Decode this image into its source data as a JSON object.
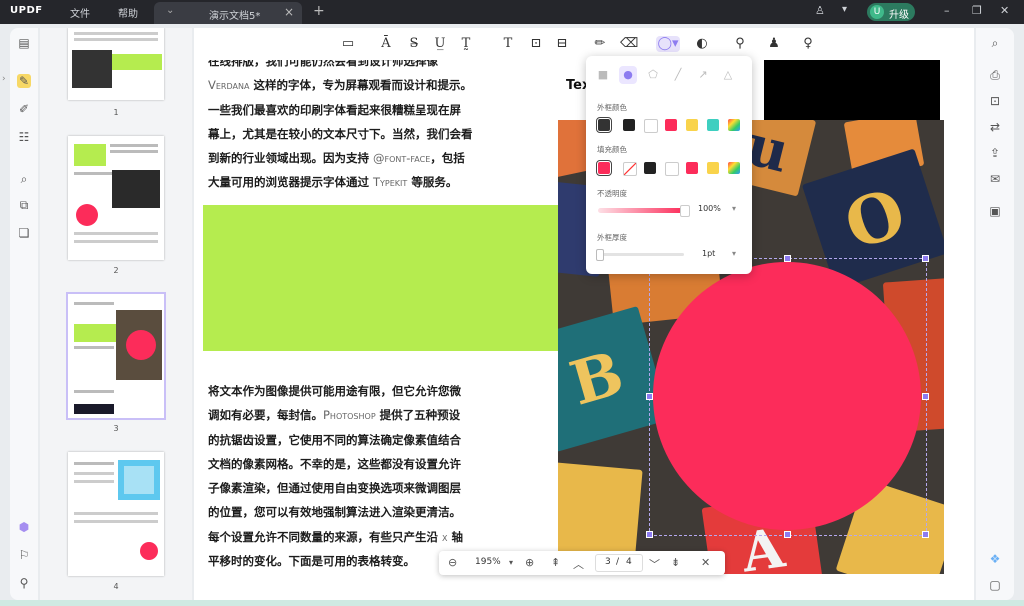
{
  "app": {
    "logo": "UPDF",
    "menu": [
      "文件",
      "帮助"
    ],
    "tab_title": "演示文档5*",
    "tab_close": "×",
    "new_tab": "+",
    "upgrade_avatar": "U",
    "upgrade_label": "升级",
    "window_controls": [
      "–",
      "❐",
      "✕"
    ]
  },
  "icons": {
    "left_rail": [
      "panel-icon",
      "highlight-tool-icon",
      "edit-icon",
      "form-icon",
      "ocr-icon",
      "organize-icon",
      "layers-icon",
      "ai-assistant-icon",
      "bookmark-icon",
      "attachment-icon"
    ],
    "right_rail": [
      "search-icon",
      "print-icon",
      "protect-icon",
      "convert-icon",
      "share-icon",
      "email-icon",
      "save-icon",
      "app-icon",
      "comment-icon"
    ]
  },
  "thumbnails": [
    {
      "label": "1"
    },
    {
      "label": "2"
    },
    {
      "label": "3"
    },
    {
      "label": "4"
    }
  ],
  "document": {
    "tex_label": "Tex",
    "paragraph1_lines": [
      [
        "在线排版，我们可能仍然会看到设计师选择像",
        ""
      ],
      [
        "",
        "Verdana",
        " 这样的字体，专为屏幕观看而设计和提示。"
      ],
      [
        "一些我们最喜欢的印刷字体看起来很糟糕呈现在屏"
      ],
      [
        "幕上，尤其是在较小的文本尺寸下。当然，我们会看"
      ],
      [
        "到新的行业领域出现。因为支持 ",
        "@font-face",
        "，包括"
      ],
      [
        "大量可用的浏览器提示字体通过 ",
        "Typekit",
        " 等服务。"
      ]
    ],
    "paragraph2_lines": [
      [
        "将文本作为图像提供可能用途有限，但它允许您微"
      ],
      [
        "调如有必要，每封信。",
        "Photoshop",
        " 提供了五种预设"
      ],
      [
        "的抗锯齿设置，它使用不同的算法确定像素值结合"
      ],
      [
        "文档的像素网格。不幸的是，这些都没有设置允许"
      ],
      [
        "子像素渲染，但通过使用自由变换选项来微调图层"
      ],
      [
        "的位置，您可以有效地强制算法进入渲染更清洁。"
      ],
      [
        "每个设置允许不同数量的来源，有些只产生沿 ",
        "x",
        " 轴"
      ],
      [
        "平移时的变化。下面是可用的表格转变。"
      ]
    ]
  },
  "shape_popup": {
    "border_color_label": "外框颜色",
    "fill_color_label": "填充颜色",
    "opacity_label": "不透明度",
    "opacity_value": "100%",
    "opacity_level": 1.0,
    "border_width_label": "外框厚度",
    "border_width_value": "1pt",
    "border_colors": [
      "#333333",
      "#222222",
      "#ffffff",
      "#fc2c5a",
      "#f9d34b",
      "#3ecfc0",
      "gradient"
    ],
    "fill_colors": [
      "#fc2c5a",
      "none",
      "#222222",
      "#ffffff",
      "#fc2c5a",
      "#f9d34b",
      "gradient"
    ]
  },
  "navbar": {
    "zoom": "195%",
    "page_current": "3",
    "page_sep": "/",
    "page_total": "4"
  },
  "colors": {
    "accent": "#8d7cf0",
    "green_block": "#b5ec4f",
    "circle_fill": "#fc2c5a"
  }
}
